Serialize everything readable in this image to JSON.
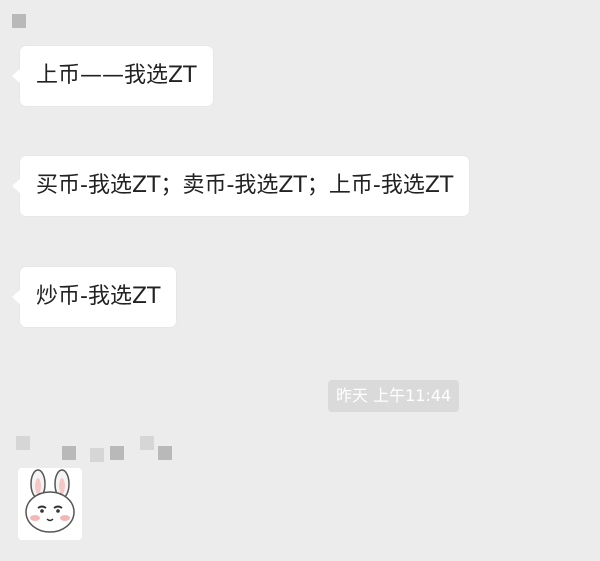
{
  "messages": [
    {
      "text": "上币——我选ZT"
    },
    {
      "text": "买币-我选ZT；卖币-我选ZT；上币-我选ZT"
    },
    {
      "text": "炒币-我选ZT"
    }
  ],
  "timestamp": "昨天 上午11:44",
  "icons": {
    "avatar": "blurred-avatar-icon",
    "sticker": "bunny-sticker-icon"
  },
  "colors": {
    "background": "#ececec",
    "bubble": "#ffffff",
    "timestamp_bg": "#dadada"
  }
}
